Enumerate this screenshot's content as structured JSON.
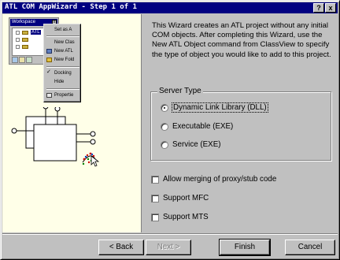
{
  "window": {
    "title": "ATL COM AppWizard - Step 1 of 1",
    "help_button": "?",
    "close_button": "x"
  },
  "illustration": {
    "workspace_title": "Workspace",
    "workspace_close": "x",
    "tree_items": [
      "",
      "ATL",
      "",
      ""
    ],
    "context_menu": [
      {
        "label": "Set as A",
        "icon": "none"
      },
      {
        "label": "New Clas",
        "icon": "none"
      },
      {
        "label": "New ATL",
        "icon": "new-atl-object-icon"
      },
      {
        "label": "New Fold",
        "icon": "new-folder-icon"
      },
      {
        "label": "Docking",
        "icon": "check-icon"
      },
      {
        "label": "Hide",
        "icon": "none"
      },
      {
        "label": "Propertie",
        "icon": "properties-icon"
      }
    ]
  },
  "intro_text": "This Wizard creates an ATL project without any initial COM objects. After completing this Wizard, use the New ATL Object command from ClassView to specify the type of object you would like to add to this project.",
  "server_type": {
    "legend": "Server Type",
    "options": [
      {
        "label": "Dynamic Link Library (DLL)",
        "checked": true
      },
      {
        "label": "Executable (EXE)",
        "checked": false
      },
      {
        "label": "Service (EXE)",
        "checked": false
      }
    ]
  },
  "checkboxes": [
    {
      "label": "Allow merging of proxy/stub code",
      "checked": false
    },
    {
      "label": "Support MFC",
      "checked": false
    },
    {
      "label": "Support MTS",
      "checked": false
    }
  ],
  "buttons": {
    "back": "< Back",
    "next": "Next >",
    "finish": "Finish",
    "cancel": "Cancel"
  },
  "colors": {
    "titlebar": "#000080",
    "dialog_face": "#c0c0c0",
    "illustration_bg": "#ffffe8"
  }
}
